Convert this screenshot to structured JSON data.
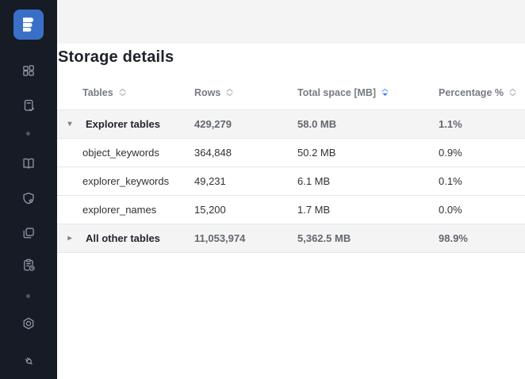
{
  "colors": {
    "sidebar_bg": "#161b26",
    "logo_blue": "#3a6fc7",
    "band_gray": "#f4f4f5",
    "accent_sort_blue": "#3d7ef0",
    "row_highlight": "#f4f4f5"
  },
  "sidebar": {
    "icons": [
      "app-logo",
      "dashboard-icon",
      "document-check-icon",
      "separator-dot",
      "book-icon",
      "shield-star-icon",
      "folders-icon",
      "clipboard-clock-icon",
      "separator-dot",
      "hexagon-settings-icon",
      "plug-icon"
    ]
  },
  "page": {
    "title": "Storage details"
  },
  "table": {
    "columns": [
      {
        "label": "Tables",
        "sort_active": false
      },
      {
        "label": "Rows",
        "sort_active": false
      },
      {
        "label": "Total space [MB]",
        "sort_active": true
      },
      {
        "label": "Percentage %",
        "sort_active": false
      }
    ],
    "rows": [
      {
        "name": "Explorer tables",
        "rows": "429,279",
        "total_space": "58.0 MB",
        "percentage": "1.1%",
        "group": true,
        "expanded": true
      },
      {
        "name": "object_keywords",
        "rows": "364,848",
        "total_space": "50.2 MB",
        "percentage": "0.9%",
        "group": false
      },
      {
        "name": "explorer_keywords",
        "rows": "49,231",
        "total_space": "6.1 MB",
        "percentage": "0.1%",
        "group": false
      },
      {
        "name": "explorer_names",
        "rows": "15,200",
        "total_space": "1.7 MB",
        "percentage": "0.0%",
        "group": false
      },
      {
        "name": "All other tables",
        "rows": "11,053,974",
        "total_space": "5,362.5 MB",
        "percentage": "98.9%",
        "group": true,
        "expanded": false
      }
    ]
  }
}
